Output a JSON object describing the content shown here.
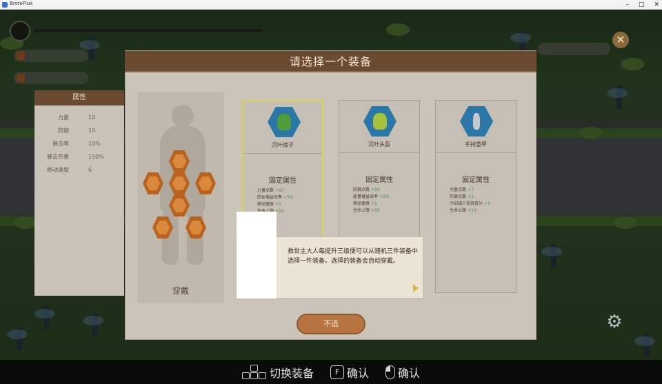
{
  "window": {
    "title": "BrotoFlux"
  },
  "attributes": {
    "header": "属性",
    "rows": [
      {
        "label": "力量",
        "value": "10"
      },
      {
        "label": "防御",
        "value": "10"
      },
      {
        "label": "暴击率",
        "value": "10%"
      },
      {
        "label": "暴击伤害",
        "value": "150%"
      },
      {
        "label": "移动速度",
        "value": "6"
      }
    ]
  },
  "modal": {
    "title": "请选择一个装备",
    "equip_label": "穿戴",
    "cards": [
      {
        "name": "沉叶裤子",
        "fixed_title": "固定属性",
        "icon_color": "#4e9c3a",
        "stats": [
          {
            "label": "力量点数",
            "bonus": "+10"
          },
          {
            "label": "回血增益效率",
            "bonus": "+5%"
          },
          {
            "label": "移动速度",
            "bonus": "+1"
          },
          {
            "label": "生命上限",
            "bonus": "+10"
          }
        ]
      },
      {
        "name": "沉叶头盔",
        "fixed_title": "固定属性",
        "icon_color": "#a6c23a",
        "stats": [
          {
            "label": "防御点数",
            "bonus": "+10"
          },
          {
            "label": "能量增益效率",
            "bonus": "+5%"
          },
          {
            "label": "移动速度",
            "bonus": "+1"
          },
          {
            "label": "生命上限",
            "bonus": "+10"
          }
        ]
      },
      {
        "name": "手持重甲",
        "fixed_title": "固定属性",
        "icon_color": "#c9c9c9",
        "stats": [
          {
            "label": "力量点数",
            "bonus": "+7"
          },
          {
            "label": "防御点数",
            "bonus": "+5"
          },
          {
            "label": "冷却减少法强百分",
            "bonus": "+3"
          },
          {
            "label": "生命上限",
            "bonus": "+10"
          }
        ]
      }
    ],
    "tooltip": "救世主大人每提升三级便可以从随机三件装备中选择一件装备。选择的装备会自动穿戴。",
    "confirm_label": "不选"
  },
  "hints": {
    "switch_label": "切换装备",
    "key_f": "F",
    "confirm_key_label": "确认",
    "confirm_mouse_label": "确认"
  }
}
